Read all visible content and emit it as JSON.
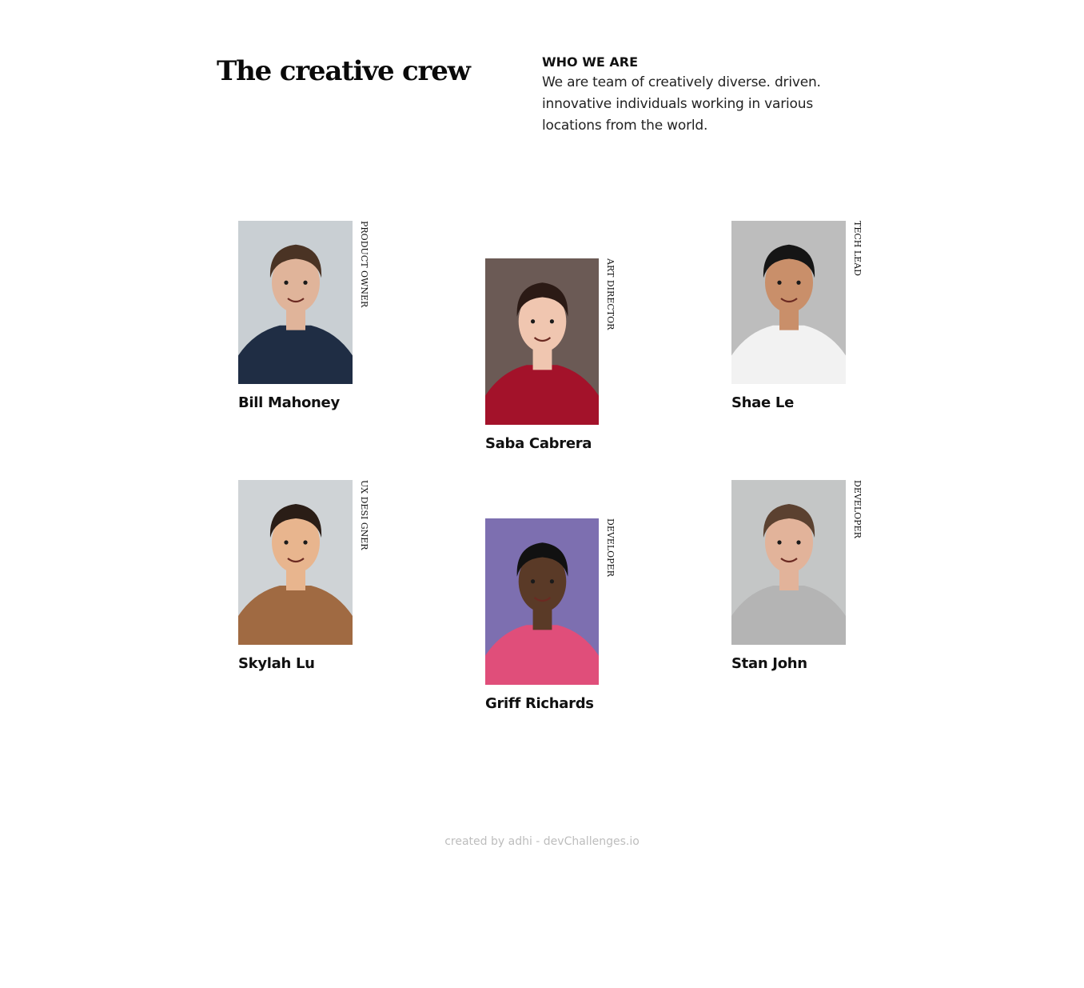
{
  "header": {
    "title": "The creative crew",
    "intro_label": "WHO WE ARE",
    "intro_text": "We are team of creatively diverse. driven. innovative individuals working in various locations from the world."
  },
  "members": [
    {
      "name": "Bill Mahoney",
      "role": "Product Owner",
      "photo_icon": "portrait-man-navy-polo",
      "bg": "#c9cfd3",
      "clothes": "#1f2d44",
      "skin": "#e0b49a",
      "hair": "#4a3324"
    },
    {
      "name": "Saba Cabrera",
      "role": "Art Director",
      "photo_icon": "portrait-woman-red-sweater",
      "bg": "#6b5a55",
      "clothes": "#a3122a",
      "skin": "#f0c6b0",
      "hair": "#2b1a15"
    },
    {
      "name": "Shae Le",
      "role": "Tech Lead",
      "photo_icon": "portrait-man-white-tshirt",
      "bg": "#bdbdbd",
      "clothes": "#f2f2f2",
      "skin": "#c98f6a",
      "hair": "#151515"
    },
    {
      "name": "Skylah Lu",
      "role": "UX Desi gner",
      "photo_icon": "portrait-woman-patterned-top",
      "bg": "#cfd3d6",
      "clothes": "#a06a42",
      "skin": "#e8b58e",
      "hair": "#2a1d16"
    },
    {
      "name": "Griff Richards",
      "role": "Developer",
      "photo_icon": "portrait-man-striped-shirt",
      "bg": "#7d6fb0",
      "clothes": "#e04e7a",
      "skin": "#5a3a27",
      "hair": "#111111"
    },
    {
      "name": "Stan John",
      "role": "Developer",
      "photo_icon": "portrait-man-grey-sweater",
      "bg": "#c4c6c6",
      "clothes": "#b4b4b4",
      "skin": "#e2b39a",
      "hair": "#5b4130"
    }
  ],
  "footer": {
    "credit": "created by adhi - devChallenges.io"
  }
}
